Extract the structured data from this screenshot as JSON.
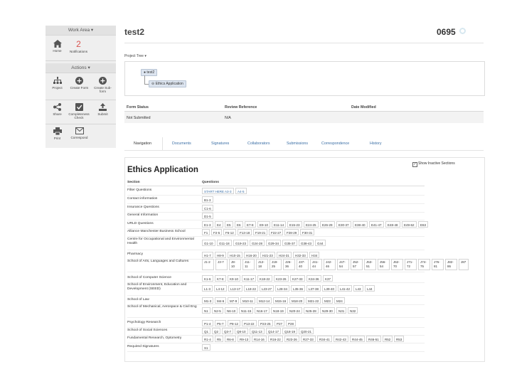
{
  "sidebar": {
    "work_area": "Work Area",
    "home": "Home",
    "notifications": "Notifications",
    "notifications_count": "2",
    "actions": "Actions",
    "project": "Project",
    "create_form": "Create Form",
    "create_sub_form": "Create Sub-form",
    "share": "Share",
    "completeness_check": "Completeness Check",
    "submit": "Submit",
    "print": "Print",
    "correspond": "Correspond"
  },
  "header": {
    "title": "test2",
    "right_number": "0695"
  },
  "project_tree": {
    "label": "Project Tree",
    "root": "test2",
    "child": "Ethics Application"
  },
  "status": {
    "headers": [
      "Form Status",
      "Review Reference",
      "Date Modified"
    ],
    "values": [
      "Not Submitted",
      "N/A",
      ""
    ]
  },
  "tabs": [
    "Navigation",
    "Documents",
    "Signatures",
    "Collaborators",
    "Submissions",
    "Correspondence",
    "History"
  ],
  "main": {
    "title": "Ethics Application",
    "show_inactive": "Show Inactive Sections",
    "col_section": "Section",
    "col_questions": "Questions"
  },
  "sections": [
    {
      "name": "Filter Questions",
      "questions": [
        "START HERE A3-3",
        "A4-5"
      ]
    },
    {
      "name": "Contact information",
      "questions": [
        "B1-3"
      ]
    },
    {
      "name": "Insurance Questions",
      "questions": [
        "C1-6"
      ]
    },
    {
      "name": "General Information",
      "questions": [
        "D1-5"
      ]
    },
    {
      "name": "URLD Questions",
      "questions": [
        "E1-3",
        "E4",
        "E5",
        "E6",
        "E7-8",
        "E9-10",
        "E11-14",
        "E15-23",
        "E24-25",
        "E26-29",
        "E30-37",
        "E38-40",
        "E41-47",
        "E48-48",
        "E49-62",
        "E63"
      ]
    },
    {
      "name": "Alliance Manchester Business School",
      "questions": [
        "F1",
        "F2-5",
        "F6-12",
        "F13-18",
        "F19-21",
        "F22-27",
        "F28-29",
        "F30-31"
      ]
    },
    {
      "name": "Centre for Occupational and Environmental Health",
      "questions": [
        "G1-10",
        "G11-18",
        "G19-23",
        "G24-28",
        "G29-34",
        "G35-37",
        "G38-43",
        "G44"
      ]
    },
    {
      "name": "Pharmacy",
      "questions": [
        "H1-7",
        "H8-9",
        "H10-15",
        "H16-20",
        "H21-23",
        "H24-31",
        "H32-33",
        "H34"
      ]
    },
    {
      "name": "School of Arts, Languages and Cultures",
      "questions": [
        "J1-2",
        "J3-7",
        "J8-10",
        "J11-11",
        "J12-18",
        "J19-25",
        "J26-36",
        "J37-40",
        "J41-44",
        "J42-46",
        "J47-54",
        "J52-57",
        "J53-51",
        "J56-54",
        "J62-70",
        "J71-72",
        "J74-75",
        "J76-81",
        "J82-86",
        "J87"
      ]
    },
    {
      "name": "School of Computer Science",
      "questions": [
        "K1-6",
        "K7-8",
        "K9-10",
        "K11-17",
        "K18-22",
        "K23-26",
        "K27-33",
        "K34-36",
        "K37"
      ]
    },
    {
      "name": "School of Environment, Education and Development (SEED)",
      "questions": [
        "L1-3",
        "L4-12",
        "L13-17",
        "L18-22",
        "L23-27",
        "L28-34",
        "L35-36",
        "L37-38",
        "L39-40",
        "L41-42",
        "L43",
        "L44"
      ]
    },
    {
      "name": "School of Law",
      "questions": [
        "M1-3",
        "M4-6",
        "M7-9",
        "M10-11",
        "M12-14",
        "M15-16",
        "M18-20",
        "M21-22",
        "M23",
        "M24"
      ]
    },
    {
      "name": "School of Mechanical, Aerospace & Civil Eng",
      "questions": [
        "N1",
        "N2-5",
        "N6-10",
        "N11-15",
        "N16-17",
        "N18-19",
        "N20-24",
        "N25-28",
        "N29-30",
        "N31",
        "N32"
      ]
    },
    {
      "name": "Psychology Research",
      "questions": [
        "P1-4",
        "P5-7",
        "P8-12",
        "P13-22",
        "P23-25",
        "P27",
        "P28"
      ]
    },
    {
      "name": "School of Social Sciences",
      "questions": [
        "Q1",
        "Q2",
        "Q3-7",
        "Q8-10",
        "Q11-13",
        "Q14-17",
        "Q18-19",
        "Q20-21"
      ]
    },
    {
      "name": "Fundamental Research, Optometry",
      "questions": [
        "R1-4",
        "R5",
        "R6-8",
        "R9-13",
        "R14-16",
        "R16-22",
        "R23-26",
        "R27-33",
        "R34-41",
        "R42-43",
        "R44-45",
        "R46-51",
        "R52",
        "R53"
      ]
    },
    {
      "name": "Required Signatures",
      "questions": [
        "S1"
      ]
    }
  ]
}
